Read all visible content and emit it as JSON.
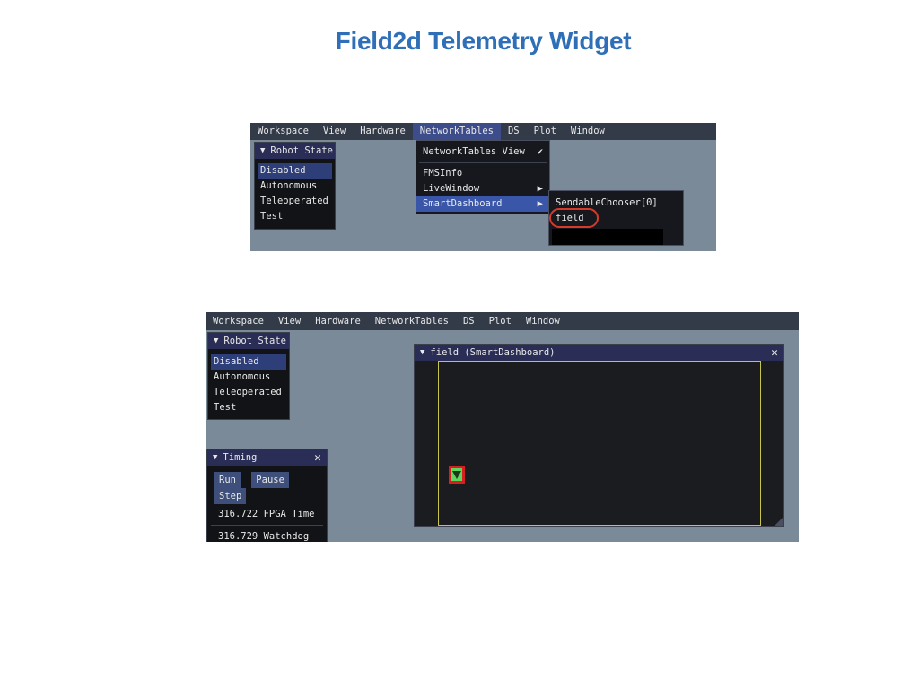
{
  "title": "Field2d Telemetry Widget",
  "shot1": {
    "menubar": [
      "Workspace",
      "View",
      "Hardware",
      "NetworkTables",
      "DS",
      "Plot",
      "Window"
    ],
    "robot_state": {
      "title": "Robot State",
      "items": [
        "Disabled",
        "Autonomous",
        "Teleoperated",
        "Test"
      ],
      "selected": "Disabled"
    },
    "nt_menu": {
      "items": [
        "NetworkTables View",
        "FMSInfo",
        "LiveWindow",
        "SmartDashboard"
      ],
      "checked": "NetworkTables View",
      "highlighted": "SmartDashboard"
    },
    "sd_submenu": {
      "items": [
        "SendableChooser[0]",
        "field"
      ],
      "circled": "field"
    },
    "icons": {
      "check": "✔",
      "arrow": "▶",
      "triangle": "▼"
    }
  },
  "shot2": {
    "menubar": [
      "Workspace",
      "View",
      "Hardware",
      "NetworkTables",
      "DS",
      "Plot",
      "Window"
    ],
    "robot_state": {
      "title": "Robot State",
      "items": [
        "Disabled",
        "Autonomous",
        "Teleoperated",
        "Test"
      ],
      "selected": "Disabled"
    },
    "timing": {
      "title": "Timing",
      "buttons": [
        "Run",
        "Pause",
        "Step"
      ],
      "fpga_value": "316.722",
      "fpga_label": "FPGA Time",
      "watchdog_value": "316.729",
      "watchdog_label": "Watchdog"
    },
    "field_window": {
      "title": "field (SmartDashboard)",
      "robot_color": "#5cd65c",
      "robot_outline": "#d62020"
    },
    "icons": {
      "close": "✕",
      "triangle": "▼"
    }
  },
  "colors": {
    "title": "#2f6fb7",
    "menubar": "#333a48",
    "highlight": "#3a56a8",
    "field_border": "#c8c450"
  }
}
